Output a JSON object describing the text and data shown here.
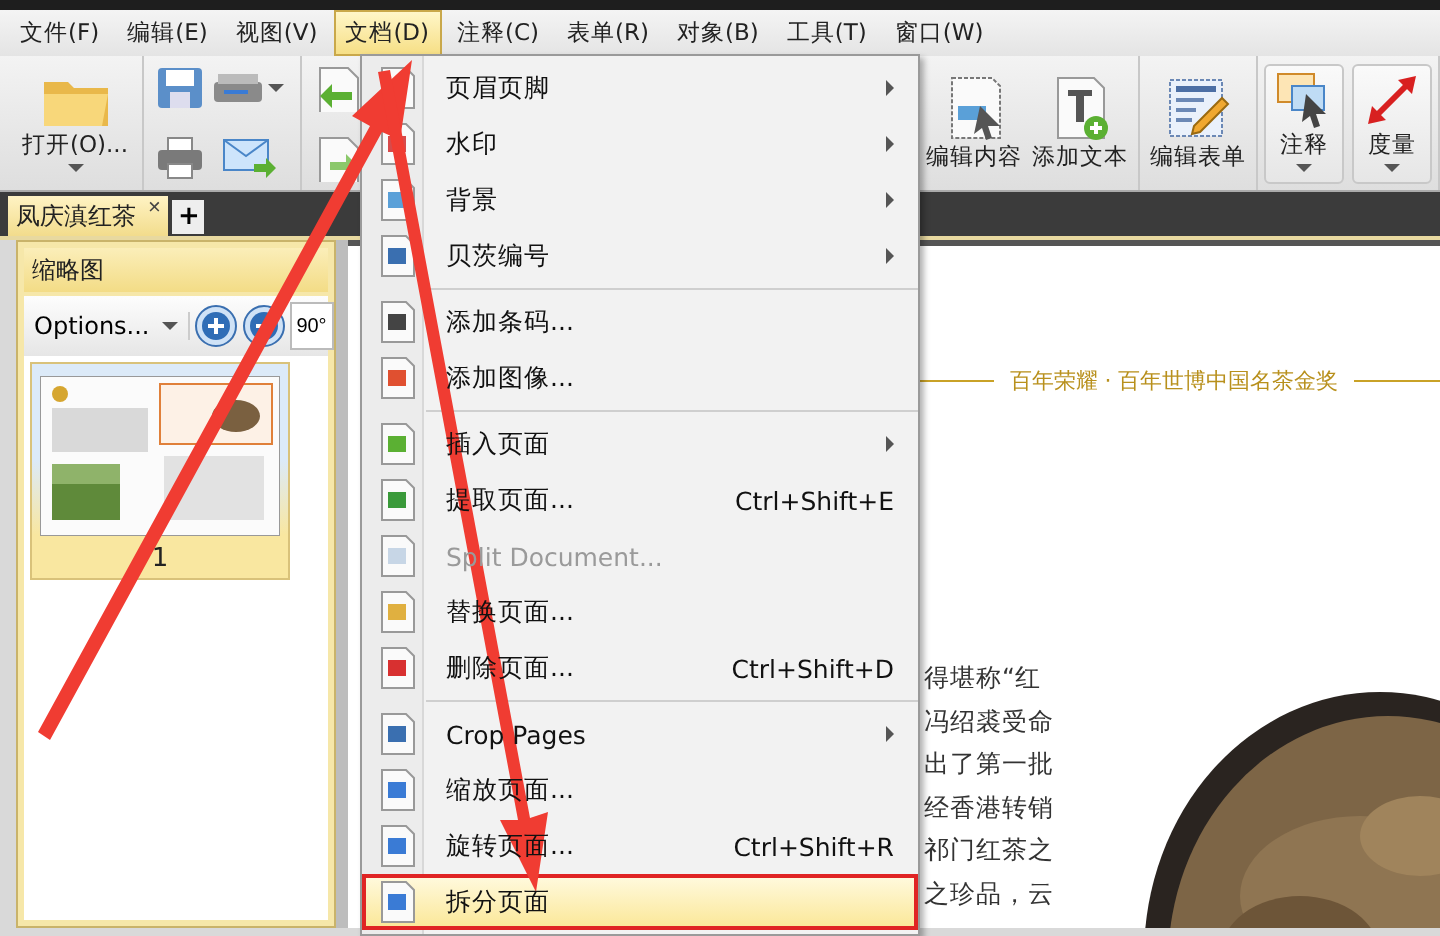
{
  "menubar": [
    {
      "label": "文件(F)",
      "selected": false
    },
    {
      "label": "编辑(E)",
      "selected": false
    },
    {
      "label": "视图(V)",
      "selected": false
    },
    {
      "label": "文档(D)",
      "selected": true
    },
    {
      "label": "注释(C)",
      "selected": false
    },
    {
      "label": "表单(R)",
      "selected": false
    },
    {
      "label": "对象(B)",
      "selected": false
    },
    {
      "label": "工具(T)",
      "selected": false
    },
    {
      "label": "窗口(W)",
      "selected": false
    }
  ],
  "toolbar": {
    "groups": [
      [
        {
          "kind": "open",
          "label": "打开(O)...",
          "dropdown": true
        }
      ],
      [
        {
          "kind": "save",
          "dropdown": false
        },
        {
          "kind": "scan",
          "dropdown": true
        },
        {
          "kind": "print",
          "dropdown": false
        },
        {
          "kind": "email",
          "dropdown": false
        }
      ],
      [
        {
          "kind": "import",
          "dropdown": false
        },
        {
          "kind": "export",
          "dropdown": false
        }
      ],
      [
        {
          "kind": "edit_content",
          "label": "编辑内容",
          "dropdown": false
        },
        {
          "kind": "add_text",
          "label": "添加文本",
          "dropdown": false
        }
      ],
      [
        {
          "kind": "edit_form",
          "label": "编辑表单",
          "dropdown": false
        }
      ],
      [
        {
          "kind": "comment",
          "label": "注释",
          "dropdown": true
        },
        {
          "kind": "measure",
          "label": "度量",
          "dropdown": true
        }
      ]
    ]
  },
  "tabs": [
    {
      "label": "凤庆滇红茶",
      "selected": true,
      "close": "×"
    }
  ],
  "new_tab": "+",
  "side_panel": {
    "title": "缩略图",
    "options": "Options...",
    "rotate_label": "90°",
    "thumbnails": [
      {
        "label": "1",
        "selected": true
      }
    ]
  },
  "document": {
    "banner": "百年荣耀 · 百年世博中国名茶金奖",
    "lines": [
      "得堪称“红",
      "冯绍裘受命",
      "出了第一批",
      "经香港转销",
      "祁门红茶之",
      "之珍品，云"
    ]
  },
  "menu": {
    "sections": [
      [
        {
          "label": "页眉页脚",
          "submenu": true,
          "disabled": false,
          "selected": false,
          "outlined": false
        },
        {
          "label": "水印",
          "submenu": true,
          "disabled": false,
          "selected": false,
          "outlined": false
        },
        {
          "label": "背景",
          "submenu": true,
          "disabled": false,
          "selected": false,
          "outlined": false
        },
        {
          "label": "贝茨编号",
          "submenu": true,
          "disabled": false,
          "selected": false,
          "outlined": false
        }
      ],
      [
        {
          "label": "添加条码...",
          "submenu": false,
          "disabled": false,
          "selected": false,
          "outlined": false
        },
        {
          "label": "添加图像...",
          "submenu": false,
          "disabled": false,
          "selected": false,
          "outlined": false
        }
      ],
      [
        {
          "label": "插入页面",
          "submenu": true,
          "disabled": false,
          "selected": false,
          "outlined": false
        },
        {
          "label": "提取页面...",
          "shortcut": "Ctrl+Shift+E",
          "submenu": false,
          "disabled": false,
          "selected": false,
          "outlined": false
        },
        {
          "label": "Split Document...",
          "submenu": false,
          "disabled": true,
          "selected": false,
          "outlined": false
        },
        {
          "label": "替换页面...",
          "submenu": false,
          "disabled": false,
          "selected": false,
          "outlined": false
        },
        {
          "label": "删除页面...",
          "shortcut": "Ctrl+Shift+D",
          "submenu": false,
          "disabled": false,
          "selected": false,
          "outlined": false
        }
      ],
      [
        {
          "label": "Crop Pages",
          "submenu": true,
          "disabled": false,
          "selected": false,
          "outlined": false
        },
        {
          "label": "缩放页面...",
          "submenu": false,
          "disabled": false,
          "selected": false,
          "outlined": false
        },
        {
          "label": "旋转页面...",
          "shortcut": "Ctrl+Shift+R",
          "submenu": false,
          "disabled": false,
          "selected": false,
          "outlined": false
        },
        {
          "label": "拆分页面",
          "submenu": false,
          "disabled": false,
          "selected": true,
          "outlined": true
        }
      ]
    ]
  }
}
